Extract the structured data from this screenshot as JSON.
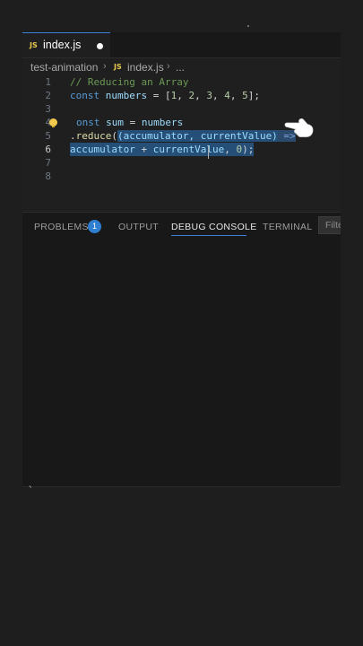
{
  "tab": {
    "icon_label": "JS",
    "filename": "index.js"
  },
  "breadcrumb": {
    "folder": "test-animation",
    "file_icon": "JS",
    "file": "index.js",
    "more": "..."
  },
  "editor": {
    "lines": [
      {
        "n": "1"
      },
      {
        "n": "2"
      },
      {
        "n": "3"
      },
      {
        "n": "4"
      },
      {
        "n": "5"
      },
      {
        "n": "6"
      },
      {
        "n": "7"
      },
      {
        "n": "8"
      }
    ],
    "tokens": {
      "l1_comment": "// Reducing an Array",
      "l2_const": "const",
      "l2_name": "numbers",
      "l2_eq": " = [",
      "l2_n1": "1",
      "l2_c1": ", ",
      "l2_n2": "2",
      "l2_c2": ", ",
      "l2_n3": "3",
      "l2_c3": ", ",
      "l2_n4": "4",
      "l2_c4": ", ",
      "l2_n5": "5",
      "l2_end": "];",
      "l4_const": "onst",
      "l4_sum": "sum",
      "l4_eq": " = ",
      "l4_numbers": "numbers",
      "l5_dot": ".",
      "l5_reduce": "reduce",
      "l5_paren": "(",
      "l5_args": "(accumulator, currentValue)",
      "l5_arrow": " =>",
      "l6_acc": "accumulator",
      "l6_plus": " + ",
      "l6_cur": "currentValue",
      "l6_comma": ", ",
      "l6_zero": "0",
      "l6_end": ");"
    },
    "active_line": "6"
  },
  "panel": {
    "tabs": [
      "PROBLEMS",
      "OUTPUT",
      "DEBUG CONSOLE",
      "TERMINAL"
    ],
    "problems_count": "1",
    "active_tab": "DEBUG CONSOLE",
    "filter_placeholder": "Filte"
  },
  "console": {
    "prompt": "`"
  },
  "colors": {
    "accent": "#3b82d6",
    "selection": "#264f78",
    "badge": "#2f7fd0",
    "js_icon": "#e6c84f"
  },
  "icons": [
    "js-file-icon",
    "unsaved-dot-icon",
    "lightbulb-icon",
    "pointing-hand-icon",
    "chevron-right-icon"
  ]
}
